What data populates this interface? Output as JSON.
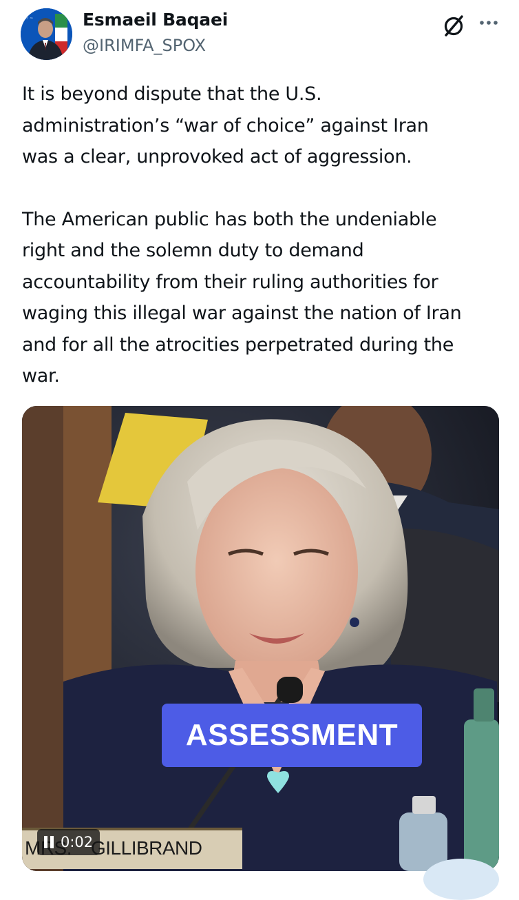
{
  "author": {
    "name": "Esmaeil Baqaei",
    "handle": "@IRIMFA_SPOX"
  },
  "icons": {
    "grok": "slashed-circle-icon",
    "more": "more-options-icon"
  },
  "tweet": {
    "paragraph_1": "It is beyond dispute that the U.S.\nadministration’s “war of choice” against Iran\nwas a clear, unprovoked act of aggression.",
    "paragraph_2": "The American public has both the undeniable\nright and the solemn duty to demand\naccountability from their ruling authorities for\nwaging this illegal war against the nation of Iran\nand for all the atrocities perpetrated during the\nwar."
  },
  "media": {
    "caption": "ASSESSMENT",
    "nameplate_prefix": "MRS.",
    "nameplate_name": "GILLIBRAND",
    "time": "0:02"
  },
  "colors": {
    "caption_bg": "#4d5ce6",
    "handle": "#536471",
    "text": "#0f1419"
  }
}
